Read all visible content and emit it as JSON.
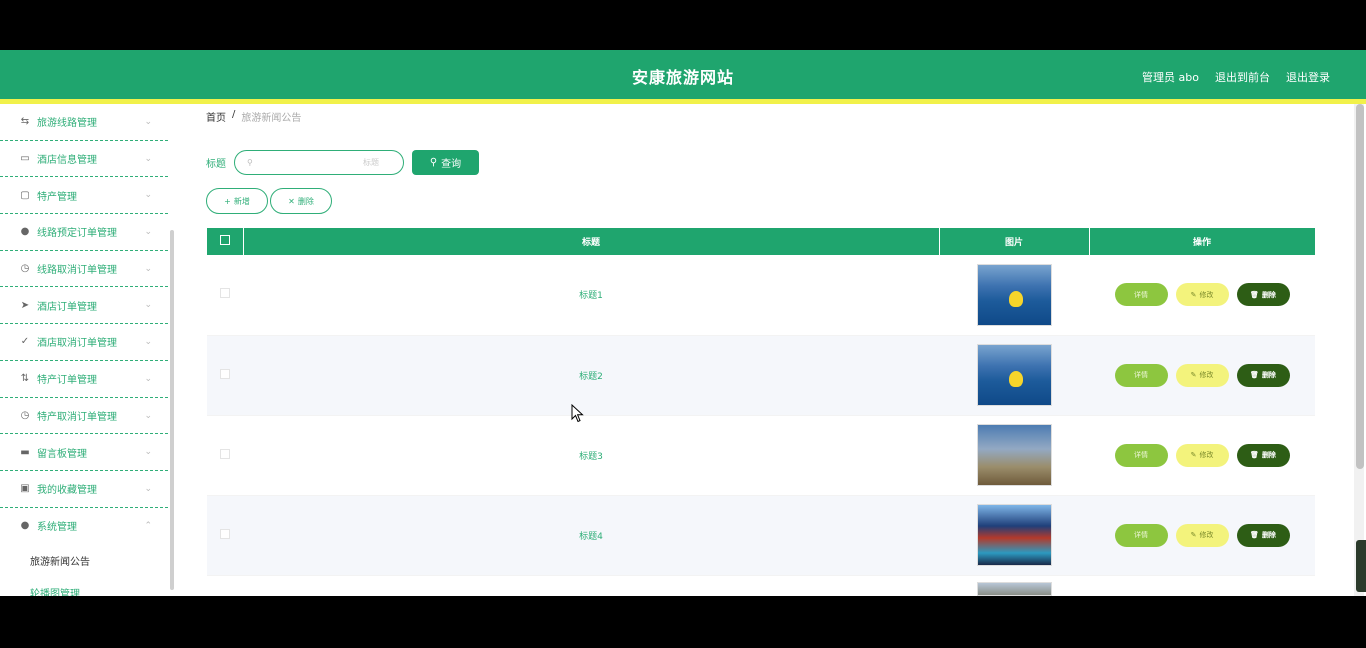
{
  "header": {
    "site_title": "安康旅游网站",
    "user_label": "管理员 abo",
    "frontend_link": "退出到前台",
    "logout_link": "退出登录"
  },
  "sidebar": {
    "items": [
      {
        "label": "旅游线路管理",
        "icon": "route-icon"
      },
      {
        "label": "酒店信息管理",
        "icon": "hotel-icon"
      },
      {
        "label": "特产管理",
        "icon": "gift-icon"
      },
      {
        "label": "线路预定订单管理",
        "icon": "user-icon"
      },
      {
        "label": "线路取消订单管理",
        "icon": "clock-icon"
      },
      {
        "label": "酒店订单管理",
        "icon": "send-icon"
      },
      {
        "label": "酒店取消订单管理",
        "icon": "check-icon"
      },
      {
        "label": "特产订单管理",
        "icon": "order-icon"
      },
      {
        "label": "特产取消订单管理",
        "icon": "clock-icon"
      },
      {
        "label": "留言板管理",
        "icon": "board-icon"
      },
      {
        "label": "我的收藏管理",
        "icon": "bookmark-icon"
      },
      {
        "label": "系统管理",
        "icon": "settings-icon"
      }
    ],
    "sub_items": [
      {
        "label": "旅游新闻公告"
      },
      {
        "label": "轮播图管理"
      }
    ]
  },
  "breadcrumb": {
    "home": "首页",
    "separator": "/",
    "current": "旅游新闻公告"
  },
  "search": {
    "label": "标题",
    "placeholder": "标题",
    "button_label": "查询"
  },
  "actions": {
    "add_label": "新增",
    "delete_label": "删除"
  },
  "table": {
    "headers": [
      "",
      "标题",
      "图片",
      "操作"
    ],
    "rows": [
      {
        "title": "标题1",
        "image": "pool"
      },
      {
        "title": "标题2",
        "image": "pool"
      },
      {
        "title": "标题3",
        "image": "tower"
      },
      {
        "title": "标题4",
        "image": "night"
      },
      {
        "title": "",
        "image": "city"
      }
    ],
    "op_detail": "详情",
    "op_edit": "修改",
    "op_delete": "删除"
  },
  "colors": {
    "primary": "#1fa56e",
    "accent_yellow": "#f1f14a",
    "detail_btn": "#8dc63f",
    "edit_btn": "#f3f37c",
    "delete_btn": "#2d5d15"
  }
}
